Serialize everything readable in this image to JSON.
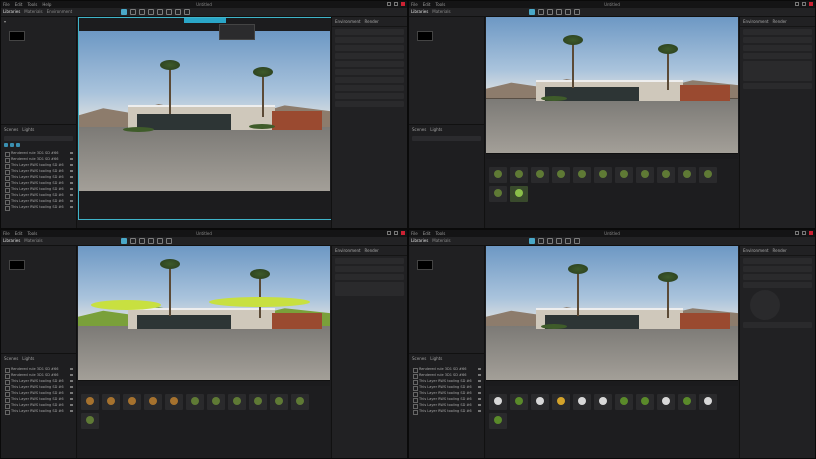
{
  "app": {
    "title": "Untitled"
  },
  "menus": [
    "File",
    "Edit",
    "Tools",
    "Help"
  ],
  "tabs": [
    "Libraries",
    "Materials",
    "Environment"
  ],
  "quadrants": [
    {
      "id": "q1",
      "left_tabs": [
        "Libraries",
        "Materials"
      ],
      "right_tabs": [
        "Environment",
        "Render"
      ],
      "bottom_tabs": [
        "Scenes",
        "Lights"
      ]
    },
    {
      "id": "q2",
      "left_tabs": [
        "Libraries",
        "Materials"
      ],
      "right_tabs": [
        "Environment",
        "Render"
      ],
      "bottom_tabs": [
        "Scenes",
        "Lights"
      ]
    },
    {
      "id": "q3",
      "left_tabs": [
        "Libraries",
        "Materials"
      ],
      "right_tabs": [
        "Environment",
        "Render"
      ],
      "bottom_tabs": [
        "Scenes",
        "Lights"
      ]
    },
    {
      "id": "q4",
      "left_tabs": [
        "Libraries",
        "Materials"
      ],
      "right_tabs": [
        "Environment",
        "Render"
      ],
      "bottom_tabs": [
        "Scenes",
        "Lights"
      ]
    }
  ],
  "scene_list": [
    "Rendered rule 3D1 SD #66",
    "Rendered rule 3D1 SD #66",
    "This Layer RWS tooling SD #6",
    "This Layer RWS tooling SD #6",
    "This Layer RWS tooling SD #6",
    "This Layer RWS tooling SD #6",
    "This Layer RWS tooling SD #6",
    "This Layer RWS tooling SD #6",
    "This Layer RWS tooling SD #6",
    "This Layer RWS tooling SD #6"
  ]
}
